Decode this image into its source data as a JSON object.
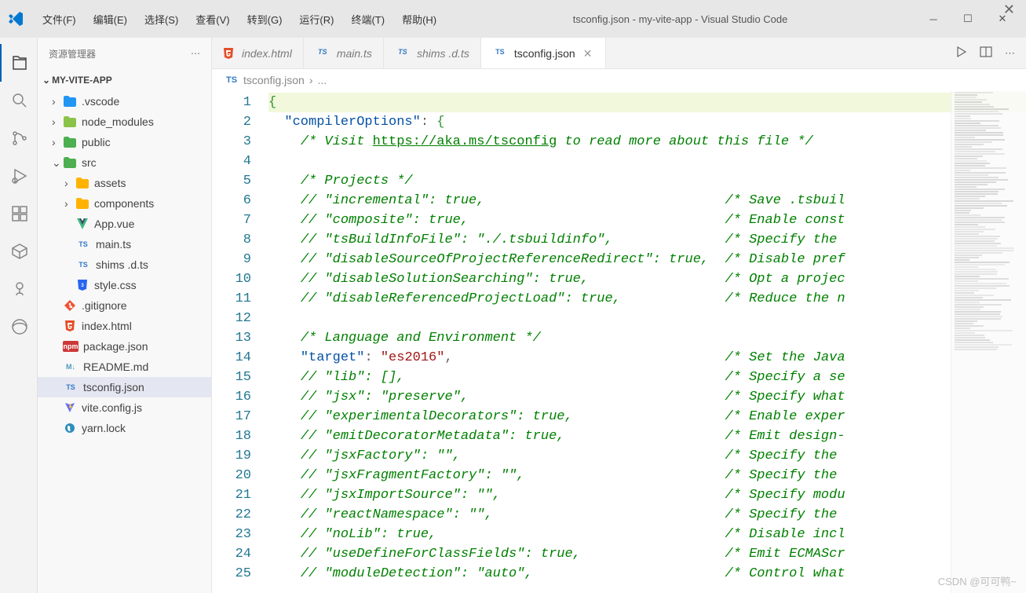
{
  "window": {
    "title": "tsconfig.json - my-vite-app - Visual Studio Code",
    "menu": [
      "文件(F)",
      "编辑(E)",
      "选择(S)",
      "查看(V)",
      "转到(G)",
      "运行(R)",
      "终端(T)",
      "帮助(H)"
    ]
  },
  "sidebar": {
    "title": "资源管理器",
    "project": "MY-VITE-APP",
    "tree": [
      {
        "label": ".vscode",
        "icon": "folder-vscode",
        "chev": ">",
        "indent": 0
      },
      {
        "label": "node_modules",
        "icon": "folder-node",
        "chev": ">",
        "indent": 0
      },
      {
        "label": "public",
        "icon": "folder-public",
        "chev": ">",
        "indent": 0
      },
      {
        "label": "src",
        "icon": "folder-src",
        "chev": "v",
        "indent": 0
      },
      {
        "label": "assets",
        "icon": "folder-assets",
        "chev": ">",
        "indent": 1
      },
      {
        "label": "components",
        "icon": "folder-components",
        "chev": ">",
        "indent": 1
      },
      {
        "label": "App.vue",
        "icon": "vue",
        "chev": "",
        "indent": 1
      },
      {
        "label": "main.ts",
        "icon": "ts",
        "chev": "",
        "indent": 1
      },
      {
        "label": "shims .d.ts",
        "icon": "ts",
        "chev": "",
        "indent": 1
      },
      {
        "label": "style.css",
        "icon": "css",
        "chev": "",
        "indent": 1
      },
      {
        "label": ".gitignore",
        "icon": "git",
        "chev": "",
        "indent": 0
      },
      {
        "label": "index.html",
        "icon": "html",
        "chev": "",
        "indent": 0
      },
      {
        "label": "package.json",
        "icon": "npm",
        "chev": "",
        "indent": 0
      },
      {
        "label": "README.md",
        "icon": "md",
        "chev": "",
        "indent": 0
      },
      {
        "label": "tsconfig.json",
        "icon": "tsj",
        "chev": "",
        "indent": 0,
        "selected": true
      },
      {
        "label": "vite.config.js",
        "icon": "vite",
        "chev": "",
        "indent": 0
      },
      {
        "label": "yarn.lock",
        "icon": "yarn",
        "chev": "",
        "indent": 0
      }
    ]
  },
  "tabs": [
    {
      "label": "index.html",
      "icon": "html",
      "active": false
    },
    {
      "label": "main.ts",
      "icon": "ts",
      "active": false
    },
    {
      "label": "shims .d.ts",
      "icon": "ts",
      "active": false
    },
    {
      "label": "tsconfig.json",
      "icon": "tsj",
      "active": true
    }
  ],
  "breadcrumb": {
    "file": "tsconfig.json",
    "rest": "..."
  },
  "code": {
    "lines": [
      {
        "n": 1,
        "hl": true,
        "html": "<span class='brace'>{</span>"
      },
      {
        "n": 2,
        "html": "  <span class='str-key'>\"compilerOptions\"</span><span class='punct'>:</span> <span class='brace'>{</span>"
      },
      {
        "n": 3,
        "html": "    <span class='comment'>/* Visit </span><span class='link'>https://aka.ms/tsconfig</span><span class='comment'> to read more about this file */</span>"
      },
      {
        "n": 4,
        "html": ""
      },
      {
        "n": 5,
        "html": "    <span class='comment'>/* Projects */</span>"
      },
      {
        "n": 6,
        "html": "    <span class='comment'>// \"incremental\": true,                              /* Save .tsbuil</span>"
      },
      {
        "n": 7,
        "html": "    <span class='comment'>// \"composite\": true,                                /* Enable const</span>"
      },
      {
        "n": 8,
        "html": "    <span class='comment'>// \"tsBuildInfoFile\": \"./.tsbuildinfo\",              /* Specify the </span>"
      },
      {
        "n": 9,
        "html": "    <span class='comment'>// \"disableSourceOfProjectReferenceRedirect\": true,  /* Disable pref</span>"
      },
      {
        "n": 10,
        "html": "    <span class='comment'>// \"disableSolutionSearching\": true,                 /* Opt a projec</span>"
      },
      {
        "n": 11,
        "html": "    <span class='comment'>// \"disableReferencedProjectLoad\": true,             /* Reduce the n</span>"
      },
      {
        "n": 12,
        "html": ""
      },
      {
        "n": 13,
        "html": "    <span class='comment'>/* Language and Environment */</span>"
      },
      {
        "n": 14,
        "html": "    <span class='str-key'>\"target\"</span><span class='punct'>:</span> <span class='str-val'>\"es2016\"</span><span class='punct'>,</span>                                  <span class='comment'>/* Set the Java</span>"
      },
      {
        "n": 15,
        "html": "    <span class='comment'>// \"lib\": [],                                        /* Specify a se</span>"
      },
      {
        "n": 16,
        "html": "    <span class='comment'>// \"jsx\": \"preserve\",                                /* Specify what</span>"
      },
      {
        "n": 17,
        "html": "    <span class='comment'>// \"experimentalDecorators\": true,                   /* Enable exper</span>"
      },
      {
        "n": 18,
        "html": "    <span class='comment'>// \"emitDecoratorMetadata\": true,                    /* Emit design-</span>"
      },
      {
        "n": 19,
        "html": "    <span class='comment'>// \"jsxFactory\": \"\",                                 /* Specify the </span>"
      },
      {
        "n": 20,
        "html": "    <span class='comment'>// \"jsxFragmentFactory\": \"\",                         /* Specify the </span>"
      },
      {
        "n": 21,
        "html": "    <span class='comment'>// \"jsxImportSource\": \"\",                            /* Specify modu</span>"
      },
      {
        "n": 22,
        "html": "    <span class='comment'>// \"reactNamespace\": \"\",                             /* Specify the </span>"
      },
      {
        "n": 23,
        "html": "    <span class='comment'>// \"noLib\": true,                                    /* Disable incl</span>"
      },
      {
        "n": 24,
        "html": "    <span class='comment'>// \"useDefineForClassFields\": true,                  /* Emit ECMAScr</span>"
      },
      {
        "n": 25,
        "html": "    <span class='comment'>// \"moduleDetection\": \"auto\",                        /* Control what</span>"
      }
    ]
  },
  "watermark": "CSDN @可可鸭~",
  "icons": {
    "html": "#e44d26",
    "ts": "#3178c6",
    "tsj": "#3178c6",
    "css": "#2965f1",
    "vue": "#41b883",
    "git": "#f05032",
    "npm": "#cb3837",
    "md": "#519aba",
    "vite": "#646cff",
    "yarn": "#2c8ebb",
    "folder-vscode": "#2196f3",
    "folder-node": "#8bc34a",
    "folder-public": "#4caf50",
    "folder-src": "#4caf50",
    "folder-assets": "#ffb300",
    "folder-components": "#ffb300"
  },
  "iconText": {
    "ts": "TS",
    "tsj": "TS",
    "html": "",
    "css": "",
    "npm": "npm",
    "md": "M↓"
  }
}
